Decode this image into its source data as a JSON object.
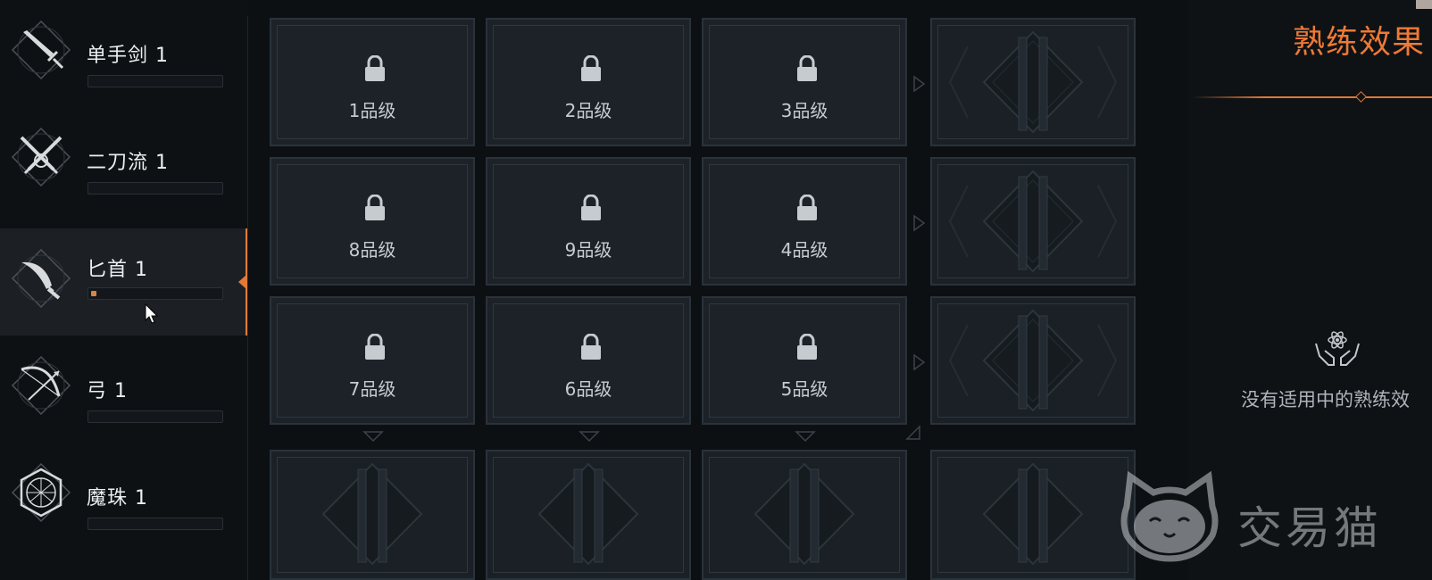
{
  "weapons": [
    {
      "name": "单手剑 1",
      "icon": "one-handed-sword-icon",
      "progress": 0,
      "active": false
    },
    {
      "name": "二刀流 1",
      "icon": "dual-blades-icon",
      "progress": 0,
      "active": false
    },
    {
      "name": "匕首 1",
      "icon": "dagger-icon",
      "progress": 0.04,
      "active": true
    },
    {
      "name": "弓 1",
      "icon": "bow-icon",
      "progress": 0,
      "active": false
    },
    {
      "name": "魔珠 1",
      "icon": "magic-orb-icon",
      "progress": 0,
      "active": false
    }
  ],
  "grid": {
    "rows": [
      [
        "1品级",
        "2品级",
        "3品级"
      ],
      [
        "8品级",
        "9品级",
        "4品级"
      ],
      [
        "7品级",
        "6品级",
        "5品级"
      ]
    ],
    "locked": true
  },
  "panel": {
    "title": "熟练效果",
    "empty_text": "没有适用中的熟练效",
    "empty_icon": "hands-atom-icon"
  },
  "watermark": {
    "text": "交易猫",
    "logo": "cat-logo-icon"
  },
  "colors": {
    "accent": "#e07a36",
    "background": "#0d1013",
    "tile": "#1c2228"
  }
}
